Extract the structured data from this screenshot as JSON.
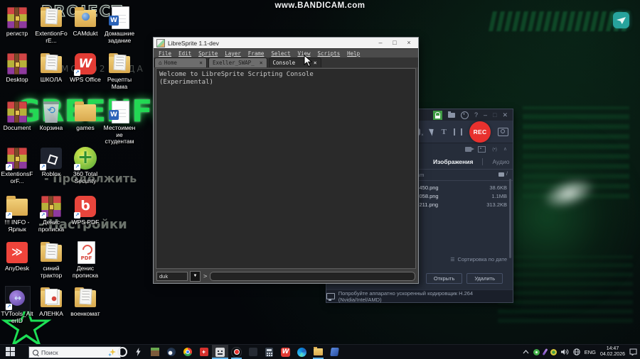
{
  "watermark": "www.BANDICAM.com",
  "wallpaper": {
    "outline_text": "PROJECT",
    "graffiti_title": "GREENFUN",
    "fragments": [
      "МО 202 ГОДА",
      "- Продолжить",
      "- Настройки"
    ],
    "accent_green": "#23d854"
  },
  "desktop": {
    "icons": [
      {
        "label": "регистр",
        "kind": "winrar",
        "col": 0,
        "row": 0
      },
      {
        "label": "ExtentionForE...",
        "kind": "folder-paper",
        "col": 1,
        "row": 0
      },
      {
        "label": "CAMdukt",
        "kind": "folder-app",
        "col": 2,
        "row": 0
      },
      {
        "label": "Домашние задание",
        "kind": "word",
        "col": 3,
        "row": 0
      },
      {
        "label": "Desktop",
        "kind": "winrar",
        "col": 0,
        "row": 1
      },
      {
        "label": "ШКОЛА",
        "kind": "folder-paper",
        "col": 1,
        "row": 1
      },
      {
        "label": "WPS Office",
        "kind": "wps",
        "col": 2,
        "row": 1,
        "shortcut": true
      },
      {
        "label": "Рецепты Мама",
        "kind": "folder-paper",
        "col": 3,
        "row": 1
      },
      {
        "label": "Document",
        "kind": "winrar",
        "col": 0,
        "row": 2
      },
      {
        "label": "Корзина",
        "kind": "recycle",
        "col": 1,
        "row": 2
      },
      {
        "label": "games",
        "kind": "folder",
        "col": 2,
        "row": 2
      },
      {
        "label": "Местоимение студентам",
        "kind": "word",
        "col": 3,
        "row": 2
      },
      {
        "label": "ExtentionsForF...",
        "kind": "winrar",
        "col": 0,
        "row": 3,
        "shortcut": true
      },
      {
        "label": "Roblox",
        "kind": "roblox",
        "col": 1,
        "row": 3,
        "shortcut": true
      },
      {
        "label": "360 Total Security",
        "kind": "security",
        "col": 2,
        "row": 3,
        "shortcut": true
      },
      {
        "label": "!!! INFO - Ярлык",
        "kind": "folder",
        "col": 0,
        "row": 4,
        "shortcut": true
      },
      {
        "label": "Денис прописка",
        "kind": "winrar",
        "col": 1,
        "row": 4,
        "shortcut": true
      },
      {
        "label": "WPS PDF",
        "kind": "wpspdf",
        "col": 2,
        "row": 4,
        "shortcut": true
      },
      {
        "label": "AnyDesk",
        "kind": "anydesk",
        "col": 0,
        "row": 5
      },
      {
        "label": "синий трактор",
        "kind": "folder-paper",
        "col": 1,
        "row": 5
      },
      {
        "label": "Денис прописка",
        "kind": "pdf",
        "col": 2,
        "row": 5
      },
      {
        "label": "TVTools_AlterID",
        "kind": "tvtools",
        "col": 0,
        "row": 6,
        "shortcut": true
      },
      {
        "label": "АЛЕНКА",
        "kind": "folder-pdf",
        "col": 1,
        "row": 6
      },
      {
        "label": "военкомат",
        "kind": "folder-paper",
        "col": 2,
        "row": 6
      }
    ]
  },
  "libresprite": {
    "title": "LibreSprite 1.1-dev",
    "controls": {
      "minimize": "–",
      "maximize": "□",
      "close": "×"
    },
    "menus": [
      "File",
      "Edit",
      "Sprite",
      "Layer",
      "Frame",
      "Select",
      "View",
      "Scripts",
      "Help"
    ],
    "tabs": [
      {
        "label": "Home",
        "icon": "home",
        "close": "×"
      },
      {
        "label": "Exeller_SWAP_",
        "close": "×"
      },
      {
        "label": "Console",
        "active": true,
        "close": "×"
      }
    ],
    "console_lines": [
      "Welcome to LibreSprite Scripting Console",
      "(Experimental)"
    ],
    "engine": "duk",
    "prompt": ">"
  },
  "bandicam": {
    "controls": {
      "help": "?",
      "minimize": "–",
      "maximize": "□",
      "close": "✕"
    },
    "rec_label": "REC",
    "text_tool": "T",
    "tabs": [
      "Изображения",
      "Аудио"
    ],
    "path": "Bandicam",
    "path_slash": "/",
    "files": [
      {
        "name": "-450.png",
        "size": "38.6KB"
      },
      {
        "name": "-058.png",
        "size": "1.1MB"
      },
      {
        "name": "-211.png",
        "size": "313.2KB"
      }
    ],
    "sort_icon": "☰",
    "sort_label": "Сортировка по дате",
    "open_label": "Открыть",
    "delete_label": "Удалить",
    "footer": "Попробуйте аппаратно ускоренный кодировщик H.264 (Nvidia/Intel/AMD)",
    "signal_icon": "(•)",
    "chevron_icon": "∧"
  },
  "taskbar": {
    "search_placeholder": "Поиск",
    "apps": [
      {
        "icon": "opera"
      },
      {
        "icon": "epic-games"
      },
      {
        "icon": "minecraft"
      },
      {
        "icon": "steam"
      },
      {
        "icon": "chrome"
      },
      {
        "icon": "red-app"
      },
      {
        "icon": "libresprite",
        "active": true
      },
      {
        "icon": "bandicam",
        "running": true
      },
      {
        "icon": "ghost-app"
      },
      {
        "icon": "calculator"
      },
      {
        "icon": "wps-office"
      },
      {
        "icon": "edge"
      },
      {
        "icon": "file-explorer",
        "running": true
      },
      {
        "icon": "blue-app"
      }
    ],
    "tray": {
      "lang": "ENG",
      "time": "14:47",
      "date": "04.02.2026"
    }
  }
}
